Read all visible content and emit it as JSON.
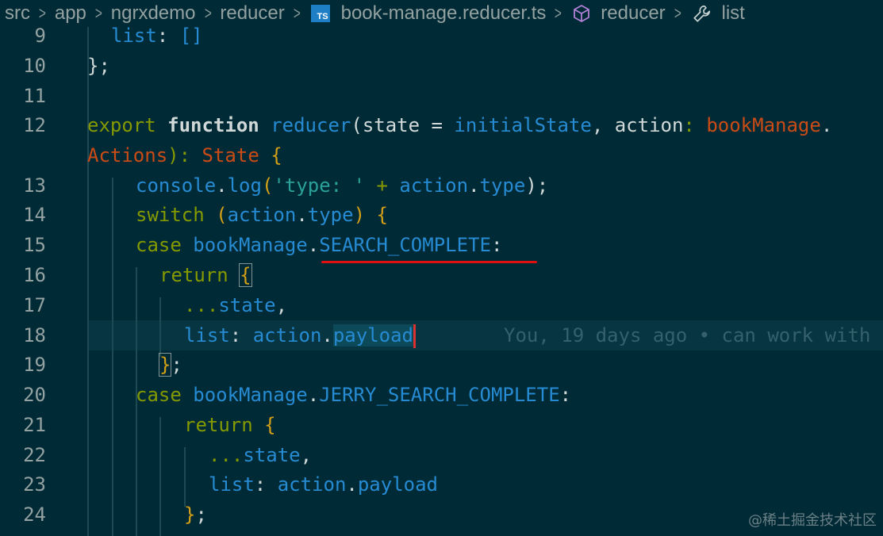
{
  "breadcrumb": {
    "items": [
      "src",
      "app",
      "ngrxdemo",
      "reducer",
      "book-manage.reducer.ts",
      "reducer",
      "list"
    ],
    "ts_badge": "TS"
  },
  "code": {
    "line_numbers": [
      "9",
      "10",
      "11",
      "12",
      "",
      "13",
      "14",
      "15",
      "16",
      "17",
      "18",
      "19",
      "20",
      "21",
      "22",
      "23",
      "24"
    ],
    "l9": {
      "name": "list",
      "colon": ": ",
      "brackets": "[]"
    },
    "l10": {
      "text": "};"
    },
    "l12a": {
      "export": "export",
      "function": "function",
      "name": "reducer",
      "open": "(",
      "state": "state",
      "eq": " = ",
      "init": "initialState",
      "comma": ", ",
      "action": "action",
      "colon": ": ",
      "type": "bookManage",
      "dot": "."
    },
    "l12b": {
      "type": "Actions",
      "close": "): ",
      "ret": "State",
      "brace": "{"
    },
    "l13": {
      "console": "console",
      "dot": ".",
      "log": "log",
      "open": "(",
      "str": "'type: '",
      "plus": " + ",
      "action": "action",
      "dot2": ".",
      "type": "type",
      "close": ");"
    },
    "l14": {
      "switch": "switch",
      "open": "(",
      "action": "action",
      "dot": ".",
      "type": "type",
      "close": ")",
      "brace": "{"
    },
    "l15": {
      "case": "case",
      "ns": "bookManage",
      "dot": ".",
      "member": "SEARCH_COMPLETE",
      "colon": ":"
    },
    "l16": {
      "return": "return",
      "brace": "{"
    },
    "l17": {
      "spread": "...",
      "state": "state",
      "comma": ","
    },
    "l18": {
      "list": "list",
      "colon": ": ",
      "action": "action",
      "dot": ".",
      "payload": "payload"
    },
    "l18_blame": "You, 19 days ago • can work with",
    "l19": {
      "brace": "}",
      "semi": ";"
    },
    "l20": {
      "case": "case",
      "ns": "bookManage",
      "dot": ".",
      "member": "JERRY_SEARCH_COMPLETE",
      "colon": ":"
    },
    "l21": {
      "return": "return",
      "brace": "{"
    },
    "l22": {
      "spread": "...",
      "state": "state",
      "comma": ","
    },
    "l23": {
      "list": "list",
      "colon": ": ",
      "action": "action",
      "dot": ".",
      "payload": "payload"
    },
    "l24": {
      "brace": "}",
      "semi": ";"
    }
  },
  "watermark": "@稀土掘金技术社区",
  "colors": {
    "background": "#002b36",
    "keyword": "#859900",
    "identifier": "#268bd2",
    "string": "#2aa198",
    "type": "#cb4b16",
    "annotation_line": "#e01010"
  }
}
